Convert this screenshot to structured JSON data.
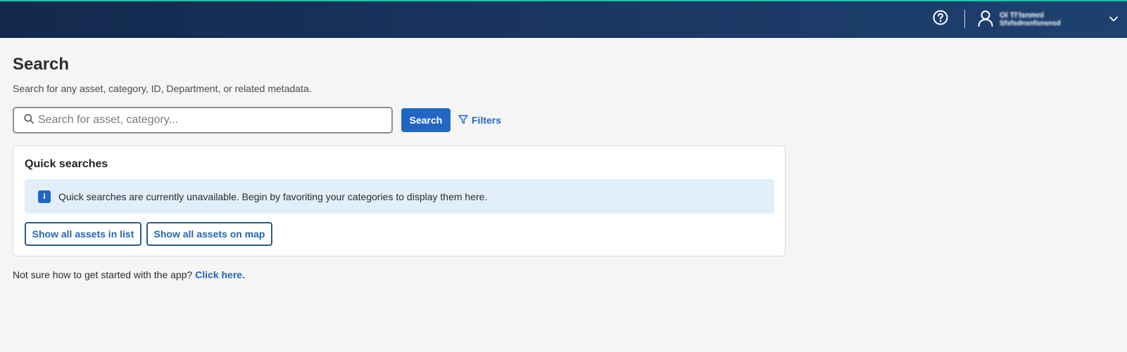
{
  "header": {
    "help_icon": "help-circle-icon",
    "user_icon": "user-icon",
    "user_name": "Ol Tl’lsnmnl",
    "user_subtitle": "Sfsfsdnsnfsnsnsd",
    "dropdown_icon": "chevron-down-icon",
    "accent_color": "#19c2a6",
    "bg_color": "#1a3763"
  },
  "page": {
    "title": "Search",
    "subtitle": "Search for any asset, category, ID, Department, or related metadata."
  },
  "search": {
    "icon": "search-icon",
    "placeholder": "Search for asset, category...",
    "value": "",
    "button_label": "Search",
    "filters_label": "Filters",
    "filters_icon": "filter-icon"
  },
  "quick_searches": {
    "title": "Quick searches",
    "info_icon": "info-icon",
    "info_glyph": "i",
    "info_message": "Quick searches are currently unavailable. Begin by favoriting your categories to display them here.",
    "show_list_label": "Show all assets in list",
    "show_map_label": "Show all assets on map"
  },
  "footer": {
    "prompt": "Not sure how to get started with the app?",
    "link_label": "Click here."
  },
  "colors": {
    "primary": "#2266c4",
    "info_bg": "#e3eefb",
    "page_bg": "#f5f5f5"
  }
}
